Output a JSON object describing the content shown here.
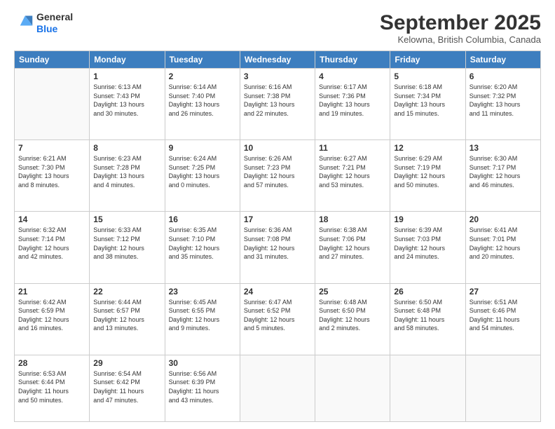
{
  "header": {
    "logo": {
      "line1": "General",
      "line2": "Blue"
    },
    "title": "September 2025",
    "location": "Kelowna, British Columbia, Canada"
  },
  "days_of_week": [
    "Sunday",
    "Monday",
    "Tuesday",
    "Wednesday",
    "Thursday",
    "Friday",
    "Saturday"
  ],
  "weeks": [
    [
      {
        "day": "",
        "info": ""
      },
      {
        "day": "1",
        "info": "Sunrise: 6:13 AM\nSunset: 7:43 PM\nDaylight: 13 hours\nand 30 minutes."
      },
      {
        "day": "2",
        "info": "Sunrise: 6:14 AM\nSunset: 7:40 PM\nDaylight: 13 hours\nand 26 minutes."
      },
      {
        "day": "3",
        "info": "Sunrise: 6:16 AM\nSunset: 7:38 PM\nDaylight: 13 hours\nand 22 minutes."
      },
      {
        "day": "4",
        "info": "Sunrise: 6:17 AM\nSunset: 7:36 PM\nDaylight: 13 hours\nand 19 minutes."
      },
      {
        "day": "5",
        "info": "Sunrise: 6:18 AM\nSunset: 7:34 PM\nDaylight: 13 hours\nand 15 minutes."
      },
      {
        "day": "6",
        "info": "Sunrise: 6:20 AM\nSunset: 7:32 PM\nDaylight: 13 hours\nand 11 minutes."
      }
    ],
    [
      {
        "day": "7",
        "info": "Sunrise: 6:21 AM\nSunset: 7:30 PM\nDaylight: 13 hours\nand 8 minutes."
      },
      {
        "day": "8",
        "info": "Sunrise: 6:23 AM\nSunset: 7:28 PM\nDaylight: 13 hours\nand 4 minutes."
      },
      {
        "day": "9",
        "info": "Sunrise: 6:24 AM\nSunset: 7:25 PM\nDaylight: 13 hours\nand 0 minutes."
      },
      {
        "day": "10",
        "info": "Sunrise: 6:26 AM\nSunset: 7:23 PM\nDaylight: 12 hours\nand 57 minutes."
      },
      {
        "day": "11",
        "info": "Sunrise: 6:27 AM\nSunset: 7:21 PM\nDaylight: 12 hours\nand 53 minutes."
      },
      {
        "day": "12",
        "info": "Sunrise: 6:29 AM\nSunset: 7:19 PM\nDaylight: 12 hours\nand 50 minutes."
      },
      {
        "day": "13",
        "info": "Sunrise: 6:30 AM\nSunset: 7:17 PM\nDaylight: 12 hours\nand 46 minutes."
      }
    ],
    [
      {
        "day": "14",
        "info": "Sunrise: 6:32 AM\nSunset: 7:14 PM\nDaylight: 12 hours\nand 42 minutes."
      },
      {
        "day": "15",
        "info": "Sunrise: 6:33 AM\nSunset: 7:12 PM\nDaylight: 12 hours\nand 38 minutes."
      },
      {
        "day": "16",
        "info": "Sunrise: 6:35 AM\nSunset: 7:10 PM\nDaylight: 12 hours\nand 35 minutes."
      },
      {
        "day": "17",
        "info": "Sunrise: 6:36 AM\nSunset: 7:08 PM\nDaylight: 12 hours\nand 31 minutes."
      },
      {
        "day": "18",
        "info": "Sunrise: 6:38 AM\nSunset: 7:06 PM\nDaylight: 12 hours\nand 27 minutes."
      },
      {
        "day": "19",
        "info": "Sunrise: 6:39 AM\nSunset: 7:03 PM\nDaylight: 12 hours\nand 24 minutes."
      },
      {
        "day": "20",
        "info": "Sunrise: 6:41 AM\nSunset: 7:01 PM\nDaylight: 12 hours\nand 20 minutes."
      }
    ],
    [
      {
        "day": "21",
        "info": "Sunrise: 6:42 AM\nSunset: 6:59 PM\nDaylight: 12 hours\nand 16 minutes."
      },
      {
        "day": "22",
        "info": "Sunrise: 6:44 AM\nSunset: 6:57 PM\nDaylight: 12 hours\nand 13 minutes."
      },
      {
        "day": "23",
        "info": "Sunrise: 6:45 AM\nSunset: 6:55 PM\nDaylight: 12 hours\nand 9 minutes."
      },
      {
        "day": "24",
        "info": "Sunrise: 6:47 AM\nSunset: 6:52 PM\nDaylight: 12 hours\nand 5 minutes."
      },
      {
        "day": "25",
        "info": "Sunrise: 6:48 AM\nSunset: 6:50 PM\nDaylight: 12 hours\nand 2 minutes."
      },
      {
        "day": "26",
        "info": "Sunrise: 6:50 AM\nSunset: 6:48 PM\nDaylight: 11 hours\nand 58 minutes."
      },
      {
        "day": "27",
        "info": "Sunrise: 6:51 AM\nSunset: 6:46 PM\nDaylight: 11 hours\nand 54 minutes."
      }
    ],
    [
      {
        "day": "28",
        "info": "Sunrise: 6:53 AM\nSunset: 6:44 PM\nDaylight: 11 hours\nand 50 minutes."
      },
      {
        "day": "29",
        "info": "Sunrise: 6:54 AM\nSunset: 6:42 PM\nDaylight: 11 hours\nand 47 minutes."
      },
      {
        "day": "30",
        "info": "Sunrise: 6:56 AM\nSunset: 6:39 PM\nDaylight: 11 hours\nand 43 minutes."
      },
      {
        "day": "",
        "info": ""
      },
      {
        "day": "",
        "info": ""
      },
      {
        "day": "",
        "info": ""
      },
      {
        "day": "",
        "info": ""
      }
    ]
  ]
}
